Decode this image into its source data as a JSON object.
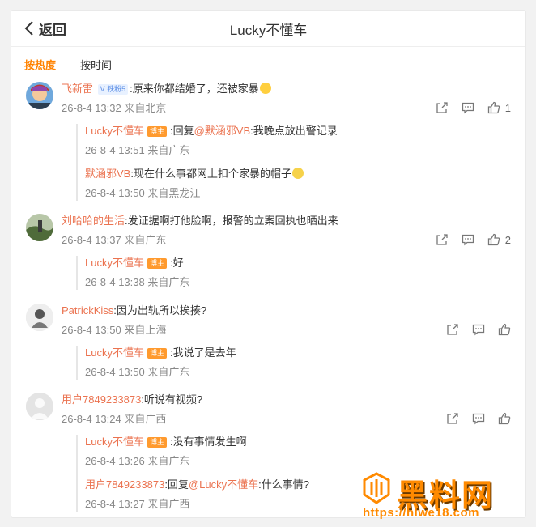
{
  "header": {
    "back_label": "返回",
    "title": "Lucky不懂车"
  },
  "tabs": [
    {
      "label": "按热度",
      "active": true
    },
    {
      "label": "按时间",
      "active": false
    }
  ],
  "comments": [
    {
      "user": "飞新雷",
      "vip": "V 铁粉5",
      "text": ":原来你都结婚了，还被家暴",
      "meta": "26-8-4 13:32 来自北京",
      "likes": "1",
      "replies": [
        {
          "user": "Lucky不懂车",
          "host": "博主",
          "pre": ":回复",
          "at": "@默涵邪VB",
          "text": ":我晚点放出警记录",
          "meta": "26-8-4 13:51 来自广东"
        },
        {
          "user": "默涵邪VB",
          "text": ":现在什么事都网上扣个家暴的帽子",
          "meta": "26-8-4 13:50 来自黑龙江"
        }
      ]
    },
    {
      "user": "刘哈哈的生活",
      "text": ":发证据啊打他脸啊，报警的立案回执也晒出来",
      "meta": "26-8-4 13:37 来自广东",
      "likes": "2",
      "replies": [
        {
          "user": "Lucky不懂车",
          "host": "博主",
          "text": ":好",
          "meta": "26-8-4 13:38 来自广东"
        }
      ]
    },
    {
      "user": "PatrickKiss",
      "text": ":因为出轨所以挨揍?",
      "meta": "26-8-4 13:50 来自上海",
      "likes": "",
      "replies": [
        {
          "user": "Lucky不懂车",
          "host": "博主",
          "text": ":我说了是去年",
          "meta": "26-8-4 13:50 来自广东"
        }
      ]
    },
    {
      "user": "用户7849233873",
      "text": ":听说有视频?",
      "meta": "26-8-4 13:24 来自广西",
      "likes": "",
      "replies": [
        {
          "user": "Lucky不懂车",
          "host": "博主",
          "text": ":没有事情发生啊",
          "meta": "26-8-4 13:26 来自广东"
        },
        {
          "user": "用户7849233873",
          "pre": ":回复",
          "at": "@Lucky不懂车",
          "text": ":什么事情?",
          "meta": "26-8-4 13:27 来自广西"
        }
      ]
    }
  ],
  "watermark": {
    "title": "黑料网",
    "url": "https://hlwe18.com"
  },
  "colors": {
    "accent": "#ff8200",
    "username": "#eb7350",
    "meta": "#888888"
  }
}
